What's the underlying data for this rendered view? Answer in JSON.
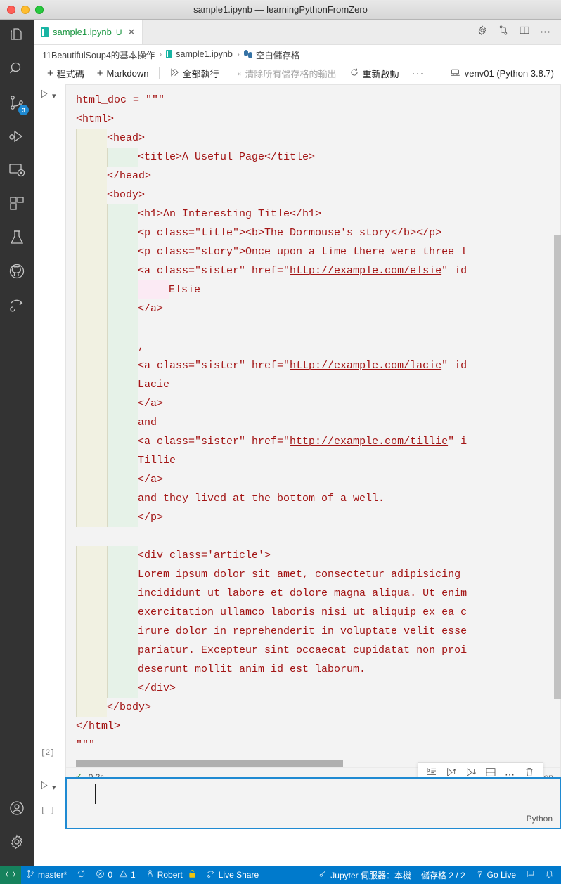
{
  "window": {
    "title": "sample1.ipynb — learningPythonFromZero",
    "traffic_lights": [
      "close",
      "minimize",
      "zoom"
    ]
  },
  "activitybar": {
    "items": [
      {
        "name": "explorer",
        "icon": "files-icon",
        "badge": null
      },
      {
        "name": "search",
        "icon": "search-icon",
        "badge": null
      },
      {
        "name": "source-control",
        "icon": "source-control-icon",
        "badge": "3"
      },
      {
        "name": "run-and-debug",
        "icon": "run-debug-icon",
        "badge": null
      },
      {
        "name": "remote-explorer",
        "icon": "remote-explorer-icon",
        "badge": null
      },
      {
        "name": "extensions",
        "icon": "extensions-icon",
        "badge": null
      },
      {
        "name": "testing",
        "icon": "beaker-icon",
        "badge": null
      },
      {
        "name": "github",
        "icon": "github-icon",
        "badge": null
      },
      {
        "name": "live-share",
        "icon": "live-share-icon",
        "badge": null
      }
    ],
    "bottom_items": [
      {
        "name": "accounts",
        "icon": "account-icon"
      },
      {
        "name": "manage-settings",
        "icon": "gear-icon"
      }
    ]
  },
  "tab": {
    "label": "sample1.ipynb",
    "dirty_indicator": "U",
    "close_label": "✕",
    "actions": [
      "gear-icon",
      "diff-icon",
      "split-editor-icon",
      "more-actions-icon"
    ]
  },
  "breadcrumb": {
    "items": [
      {
        "label": "11BeautifulSoup4的基本操作",
        "icon": null
      },
      {
        "label": "sample1.ipynb",
        "icon": "notebook-icon"
      },
      {
        "label": "空白儲存格",
        "icon": "python-icon"
      }
    ],
    "separator": "›"
  },
  "notebook_toolbar": {
    "add_code": "程式碼",
    "add_markdown": "Markdown",
    "run_all": "全部執行",
    "clear_outputs": "清除所有儲存格的輸出",
    "restart": "重新啟動",
    "more": "···",
    "kernel": "venv01 (Python 3.8.7)"
  },
  "cells": [
    {
      "execution_count": "[2]",
      "language": "Python",
      "status_time": "0.2s",
      "status_icon": "check-icon",
      "code_lines": [
        {
          "indents": [],
          "text": "html_doc = \"\"\""
        },
        {
          "indents": [],
          "text": "<html>"
        },
        {
          "indents": [
            "g1"
          ],
          "text": "<head>"
        },
        {
          "indents": [
            "g1",
            "g2"
          ],
          "text": "<title>A Useful Page</title>"
        },
        {
          "indents": [
            "g1"
          ],
          "text": "</head>"
        },
        {
          "indents": [
            "g1"
          ],
          "text": "<body>"
        },
        {
          "indents": [
            "g1",
            "g2"
          ],
          "text": "<h1>An Interesting Title</h1>"
        },
        {
          "indents": [
            "g1",
            "g2"
          ],
          "text": "<p class=\"title\"><b>The Dormouse's story</b></p>"
        },
        {
          "indents": [
            "g1",
            "g2"
          ],
          "text": "<p class=\"story\">Once upon a time there were three l"
        },
        {
          "indents": [
            "g1",
            "g2"
          ],
          "text": "<a class=\"sister\" href=\"http://example.com/elsie\" id",
          "link": "http://example.com/elsie"
        },
        {
          "indents": [
            "g1",
            "g2",
            "g3"
          ],
          "text": "Elsie"
        },
        {
          "indents": [
            "g1",
            "g2"
          ],
          "text": "</a>"
        },
        {
          "indents": [
            "g1",
            "g2"
          ],
          "text": ""
        },
        {
          "indents": [
            "g1",
            "g2"
          ],
          "text": ","
        },
        {
          "indents": [
            "g1",
            "g2"
          ],
          "text": "<a class=\"sister\" href=\"http://example.com/lacie\" id",
          "link": "http://example.com/lacie"
        },
        {
          "indents": [
            "g1",
            "g2"
          ],
          "text": "Lacie"
        },
        {
          "indents": [
            "g1",
            "g2"
          ],
          "text": "</a>"
        },
        {
          "indents": [
            "g1",
            "g2"
          ],
          "text": "and"
        },
        {
          "indents": [
            "g1",
            "g2"
          ],
          "text": "<a class=\"sister\" href=\"http://example.com/tillie\" i",
          "link": "http://example.com/tillie"
        },
        {
          "indents": [
            "g1",
            "g2"
          ],
          "text": "Tillie"
        },
        {
          "indents": [
            "g1",
            "g2"
          ],
          "text": "</a>"
        },
        {
          "indents": [
            "g1",
            "g2"
          ],
          "text": "and they lived at the bottom of a well."
        },
        {
          "indents": [
            "g1",
            "g2"
          ],
          "text": "</p>"
        },
        {
          "indents": [],
          "text": ""
        },
        {
          "indents": [
            "g1",
            "g2"
          ],
          "text": "<div class='article'>"
        },
        {
          "indents": [
            "g1",
            "g2"
          ],
          "text": "Lorem ipsum dolor sit amet, consectetur adipisicing"
        },
        {
          "indents": [
            "g1",
            "g2"
          ],
          "text": "incididunt ut labore et dolore magna aliqua. Ut enim"
        },
        {
          "indents": [
            "g1",
            "g2"
          ],
          "text": "exercitation ullamco laboris nisi ut aliquip ex ea c"
        },
        {
          "indents": [
            "g1",
            "g2"
          ],
          "text": "irure dolor in reprehenderit in voluptate velit esse"
        },
        {
          "indents": [
            "g1",
            "g2"
          ],
          "text": "pariatur. Excepteur sint occaecat cupidatat non proi"
        },
        {
          "indents": [
            "g1",
            "g2"
          ],
          "text": "deserunt mollit anim id est laborum."
        },
        {
          "indents": [
            "g1",
            "g2"
          ],
          "text": "</div>"
        },
        {
          "indents": [
            "g1"
          ],
          "text": "</body>"
        },
        {
          "indents": [],
          "text": "</html>"
        },
        {
          "indents": [],
          "text": "\"\"\""
        }
      ]
    },
    {
      "execution_count": "[ ]",
      "language": "Python",
      "code_lines": [],
      "selected": true,
      "toolbar_icons": [
        "run-by-line-icon",
        "run-above-icon",
        "run-below-icon",
        "split-cell-icon",
        "more-icon",
        "delete-cell-icon"
      ]
    }
  ],
  "statusbar": {
    "remote_icon": "remote-indicator-icon",
    "branch": "master*",
    "sync_icon": "sync-icon",
    "errors": "0",
    "warnings": "1",
    "user": "Robert",
    "user_badge_icon": "lock-icon",
    "live_share": "Live Share",
    "jupyter_server": "Jupyter 伺服器：本機",
    "cell_count": "儲存格 2 / 2",
    "go_live": "Go Live",
    "feedback_icon": "feedback-icon",
    "bell_icon": "bell-icon"
  },
  "colors": {
    "accent": "#007acc",
    "remote_green": "#16825d",
    "string_red": "#a31515",
    "badge_blue": "#1f8ad2",
    "tab_green": "#1a9641"
  }
}
